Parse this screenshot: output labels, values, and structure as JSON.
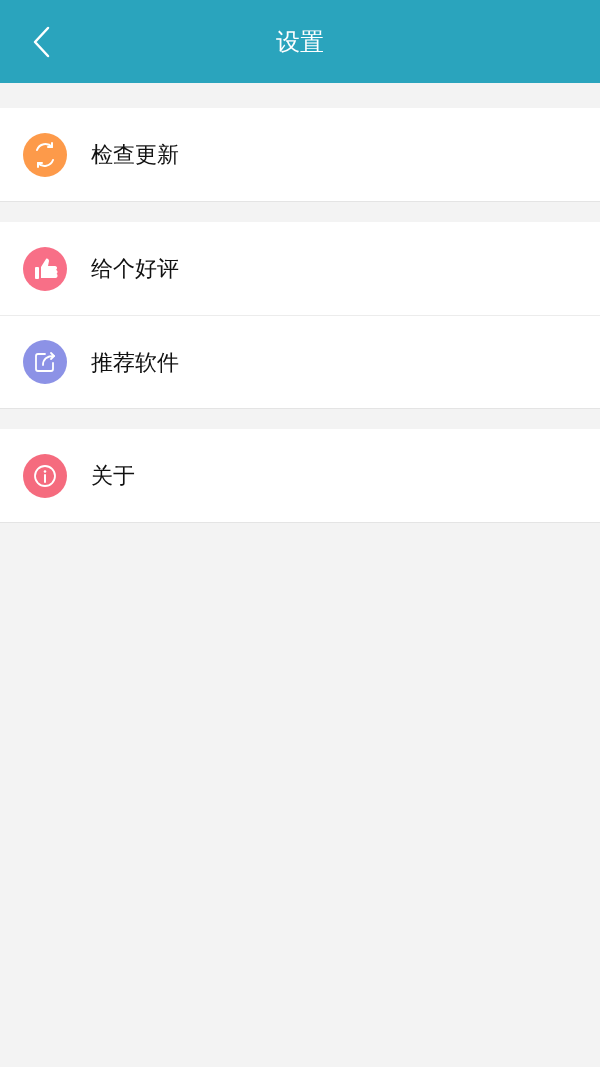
{
  "header": {
    "title": "设置"
  },
  "groups": [
    {
      "items": [
        {
          "label": "检查更新",
          "kind": "refresh",
          "color": "#fd9a4a"
        }
      ]
    },
    {
      "items": [
        {
          "label": "给个好评",
          "kind": "thumbs-up",
          "color": "#f86f87"
        },
        {
          "label": "推荐软件",
          "kind": "share",
          "color": "#8c92e6"
        }
      ]
    },
    {
      "items": [
        {
          "label": "关于",
          "kind": "info",
          "color": "#f56b7e"
        }
      ]
    }
  ]
}
